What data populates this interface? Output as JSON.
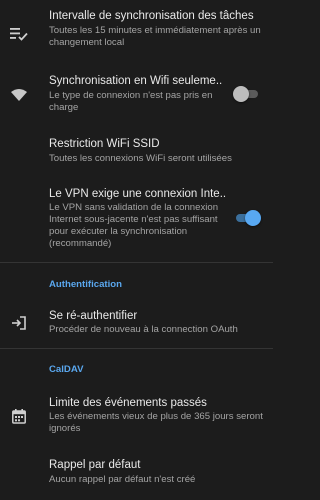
{
  "colors": {
    "background": "#1c1c1c",
    "title_text": "#e9e9e9",
    "summary_text": "#a4a4a4",
    "accent": "#5aa7ee",
    "divider": "#343434"
  },
  "prefs": {
    "sync_interval": {
      "icon": "sort-list-icon",
      "title": "Intervalle de synchronisation des tâches",
      "summary": "Toutes les 15 minutes et immédiatement après un changement local"
    },
    "wifi_only": {
      "icon": "wifi-icon",
      "title": "Synchronisation en Wifi seuleme..",
      "summary": "Le type de connexion n'est pas pris en charge",
      "enabled": false
    },
    "wifi_ssid": {
      "title": "Restriction WiFi SSID",
      "summary": "Toutes les connexions WiFi seront utilisées"
    },
    "vpn": {
      "title": "Le VPN exige une connexion Inte..",
      "summary": "Le VPN sans validation de la connexion Internet sous-jacente n'est pas suffisant pour exécuter la synchronisation (recommandé)",
      "enabled": true
    }
  },
  "categories": {
    "auth": "Authentification",
    "caldav": "CalDAV"
  },
  "auth": {
    "reauth": {
      "icon": "login-icon",
      "title": "Se ré-authentifier",
      "summary": "Procéder de nouveau à la connection OAuth"
    }
  },
  "caldav": {
    "past_events": {
      "icon": "calendar-icon",
      "title": "Limite des événements passés",
      "summary": "Les événements vieux de plus de 365 jours seront ignorés"
    },
    "default_reminder": {
      "title": "Rappel par défaut",
      "summary": "Aucun rappel par défaut n'est créé"
    }
  }
}
